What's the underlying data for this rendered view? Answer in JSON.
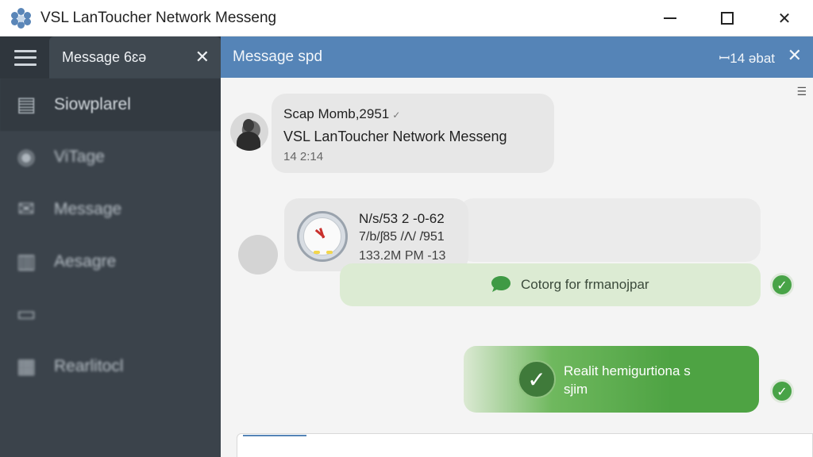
{
  "window": {
    "title": "VSL LanToucher Network Messeng",
    "minimize_label": "",
    "close_glyph": "✕"
  },
  "sidebar": {
    "tab_label": "Message 6ɛə",
    "tab_close": "✕",
    "items": [
      {
        "label": "Siowplarel",
        "icon": "clipboard-icon",
        "glyph": "▤"
      },
      {
        "label": "ViTage",
        "icon": "user-icon",
        "glyph": "◉"
      },
      {
        "label": "Message",
        "icon": "chat-icon",
        "glyph": "✉"
      },
      {
        "label": "Aesagre",
        "icon": "document-icon",
        "glyph": "▥"
      },
      {
        "label": "",
        "icon": "folder-icon",
        "glyph": "▭"
      },
      {
        "label": "Rearlitocl",
        "icon": "calendar-icon",
        "glyph": "▦"
      }
    ]
  },
  "main": {
    "title": "Message spd",
    "status": "ꟷ14 əbat",
    "close_glyph": "✕",
    "list_toggle_glyph": "☰"
  },
  "messages": {
    "m1": {
      "line1": "Scap Momb,2951",
      "tick": "✓",
      "line2": "VSL LanToucher Network Messeng",
      "time": "14 2:14"
    },
    "m2": {
      "line1": "N/s/53 2 ‑0‑62",
      "line2": "7/b/ʃ85 /Λ/ /̄951",
      "line3": "133.2M PM  ‑13"
    },
    "m3": {
      "text": "Cotorg for frmanojpar",
      "check": "✓"
    },
    "m4": {
      "line1": "Realit hemigurtiona s",
      "line2": "sjim",
      "check": "✓"
    }
  },
  "colors": {
    "header_blue": "#5584b7",
    "sidebar_dark": "#3b434b",
    "green_bubble": "#4ea343",
    "light_green_bubble": "#dcebd3"
  }
}
